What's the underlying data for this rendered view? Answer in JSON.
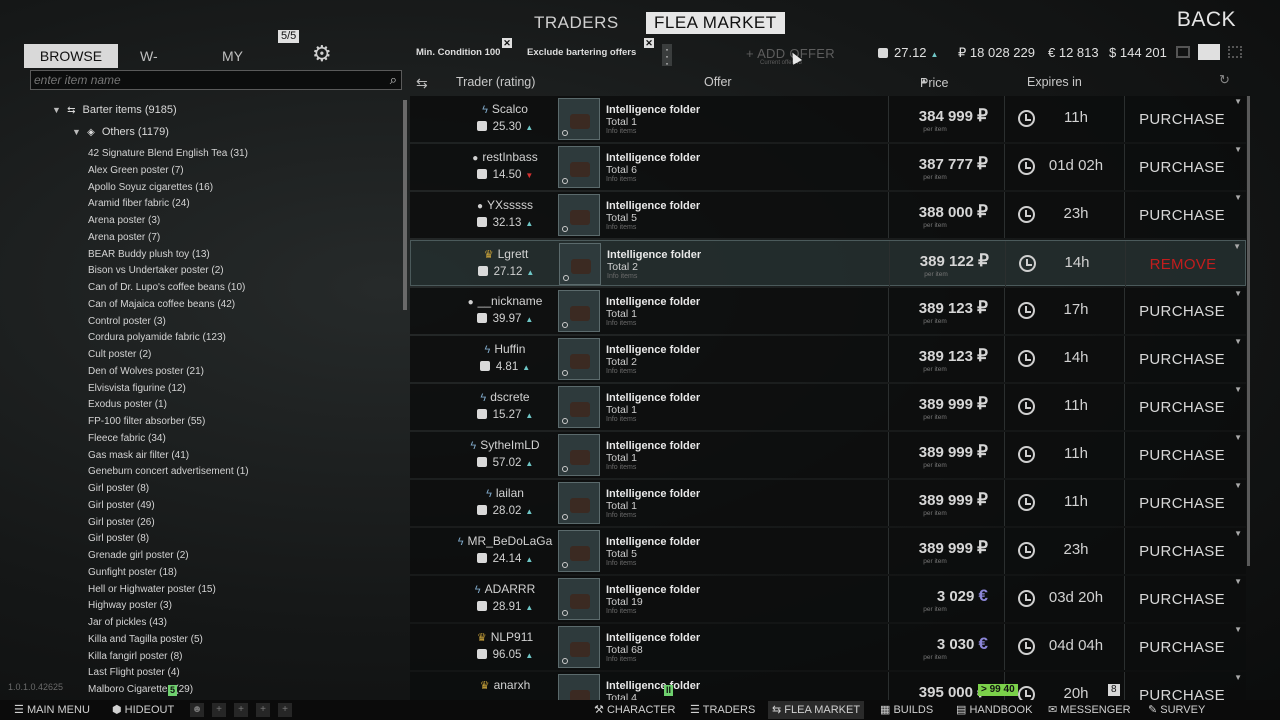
{
  "nav": {
    "traders": "TRADERS",
    "flea_market": "FLEA MARKET",
    "back": "BACK"
  },
  "tabs": {
    "browse": "BROWSE",
    "wlist": "W-LIST",
    "my_offers": "MY OFFERS",
    "offers_badge": "5/5"
  },
  "search": {
    "placeholder": "enter item name"
  },
  "tree": {
    "parent": "Barter items (9185)",
    "child": "Others (1179)",
    "items": [
      "42 Signature Blend English Tea (31)",
      "Alex Green poster (7)",
      "Apollo Soyuz cigarettes (16)",
      "Aramid fiber fabric (24)",
      "Arena poster (3)",
      "Arena poster (7)",
      "BEAR Buddy plush toy (13)",
      "Bison vs Undertaker poster (2)",
      "Can of Dr. Lupo's coffee beans (10)",
      "Can of Majaica coffee beans (42)",
      "Control poster (3)",
      "Cordura polyamide fabric (123)",
      "Cult poster (2)",
      "Den of Wolves poster (21)",
      "Elvisvista figurine (12)",
      "Exodus poster (1)",
      "FP-100 filter absorber (55)",
      "Fleece fabric (34)",
      "Gas mask air filter (41)",
      "Geneburn concert advertisement (1)",
      "Girl poster (8)",
      "Girl poster (49)",
      "Girl poster (26)",
      "Girl poster (8)",
      "Grenade girl poster (2)",
      "Gunfight poster (18)",
      "Hell or Highwater poster (15)",
      "Highway poster (3)",
      "Jar of pickles (43)",
      "Killa and Tagilla poster (5)",
      "Killa fangirl poster (8)",
      "Last Flight poster (4)",
      "Malboro Cigarettes (29)"
    ]
  },
  "filters": {
    "min_condition": "Min. Condition 100",
    "exclude_barter": "Exclude bartering offers",
    "add_offer": "+ ADD OFFER",
    "add_offer_sub": "Current offer 43"
  },
  "currencies": {
    "rating": "27.12",
    "rub": "18 028 229",
    "eur": "12 813",
    "usd": "144 201"
  },
  "columns": {
    "trader": "Trader (rating)",
    "offer": "Offer",
    "price": "Price",
    "expires": "Expires in"
  },
  "offers": [
    {
      "trader": "Scalco",
      "type": "trader",
      "rating": "25.30",
      "trend": "up",
      "title": "Intelligence folder",
      "total": "Total 1",
      "sub": "Info items",
      "price": "384 999",
      "currency": "₽",
      "per": "per item",
      "expires": "11h",
      "action": "PURCHASE"
    },
    {
      "trader": "restInbass",
      "type": "player",
      "rating": "14.50",
      "trend": "down",
      "title": "Intelligence folder",
      "total": "Total 6",
      "sub": "Info items",
      "price": "387 777",
      "currency": "₽",
      "per": "per item",
      "expires": "01d 02h",
      "action": "PURCHASE"
    },
    {
      "trader": "YXsssss",
      "type": "player",
      "rating": "32.13",
      "trend": "up",
      "title": "Intelligence folder",
      "total": "Total 5",
      "sub": "Info items",
      "price": "388 000",
      "currency": "₽",
      "per": "per item",
      "expires": "23h",
      "action": "PURCHASE"
    },
    {
      "trader": "Lgrett",
      "type": "crown",
      "rating": "27.12",
      "trend": "up",
      "title": "Intelligence folder",
      "total": "Total 2",
      "sub": "Info items",
      "price": "389 122",
      "currency": "₽",
      "per": "per item",
      "expires": "14h",
      "action": "REMOVE"
    },
    {
      "trader": "__nickname",
      "type": "player",
      "rating": "39.97",
      "trend": "up",
      "title": "Intelligence folder",
      "total": "Total 1",
      "sub": "Info items",
      "price": "389 123",
      "currency": "₽",
      "per": "per item",
      "expires": "17h",
      "action": "PURCHASE"
    },
    {
      "trader": "Huffin",
      "type": "trader",
      "rating": "4.81",
      "trend": "up",
      "title": "Intelligence folder",
      "total": "Total 2",
      "sub": "Info items",
      "price": "389 123",
      "currency": "₽",
      "per": "per item",
      "expires": "14h",
      "action": "PURCHASE"
    },
    {
      "trader": "dscrete",
      "type": "trader",
      "rating": "15.27",
      "trend": "up",
      "title": "Intelligence folder",
      "total": "Total 1",
      "sub": "Info items",
      "price": "389 999",
      "currency": "₽",
      "per": "per item",
      "expires": "11h",
      "action": "PURCHASE"
    },
    {
      "trader": "SytheImLD",
      "type": "trader",
      "rating": "57.02",
      "trend": "up",
      "title": "Intelligence folder",
      "total": "Total 1",
      "sub": "Info items",
      "price": "389 999",
      "currency": "₽",
      "per": "per item",
      "expires": "11h",
      "action": "PURCHASE"
    },
    {
      "trader": "lailan",
      "type": "trader",
      "rating": "28.02",
      "trend": "up",
      "title": "Intelligence folder",
      "total": "Total 1",
      "sub": "Info items",
      "price": "389 999",
      "currency": "₽",
      "per": "per item",
      "expires": "11h",
      "action": "PURCHASE"
    },
    {
      "trader": "MR_BeDoLaGa",
      "type": "trader",
      "rating": "24.14",
      "trend": "up",
      "title": "Intelligence folder",
      "total": "Total 5",
      "sub": "Info items",
      "price": "389 999",
      "currency": "₽",
      "per": "per item",
      "expires": "23h",
      "action": "PURCHASE"
    },
    {
      "trader": "ADARRR",
      "type": "trader",
      "rating": "28.91",
      "trend": "up",
      "title": "Intelligence folder",
      "total": "Total 19",
      "sub": "Info items",
      "price": "3 029",
      "currency": "€",
      "per": "per item",
      "expires": "03d 20h",
      "action": "PURCHASE"
    },
    {
      "trader": "NLP911",
      "type": "crown",
      "rating": "96.05",
      "trend": "up",
      "title": "Intelligence folder",
      "total": "Total 68",
      "sub": "Info items",
      "price": "3 030",
      "currency": "€",
      "per": "per item",
      "expires": "04d 04h",
      "action": "PURCHASE"
    },
    {
      "trader": "anarxh",
      "type": "crown",
      "rating": "",
      "trend": "",
      "title": "Intelligence folder",
      "total": "Total 4",
      "sub": "Info items",
      "price": "395 000",
      "currency": "₽",
      "per": "per item",
      "expires": "20h",
      "action": "PURCHASE"
    }
  ],
  "bottom": {
    "version": "1.0.1.0.42625",
    "main_menu": "MAIN MENU",
    "hideout": "HIDEOUT",
    "hideout_badge": "5",
    "character": "CHARACTER",
    "traders": "TRADERS",
    "flea_market": "FLEA MARKET",
    "builds": "BUILDS",
    "handbook": "HANDBOOK",
    "messenger": "MESSENGER",
    "survey": "SURVEY",
    "trade_badge": "> 99  40",
    "warn_badge": "8",
    "small_badge": "II"
  },
  "colors": {
    "remove": "#c21d1d",
    "eur": "#8c86d8",
    "trend_up": "#6fc7c7",
    "trend_down": "#d43030",
    "green_badge": "#7bd14a"
  }
}
